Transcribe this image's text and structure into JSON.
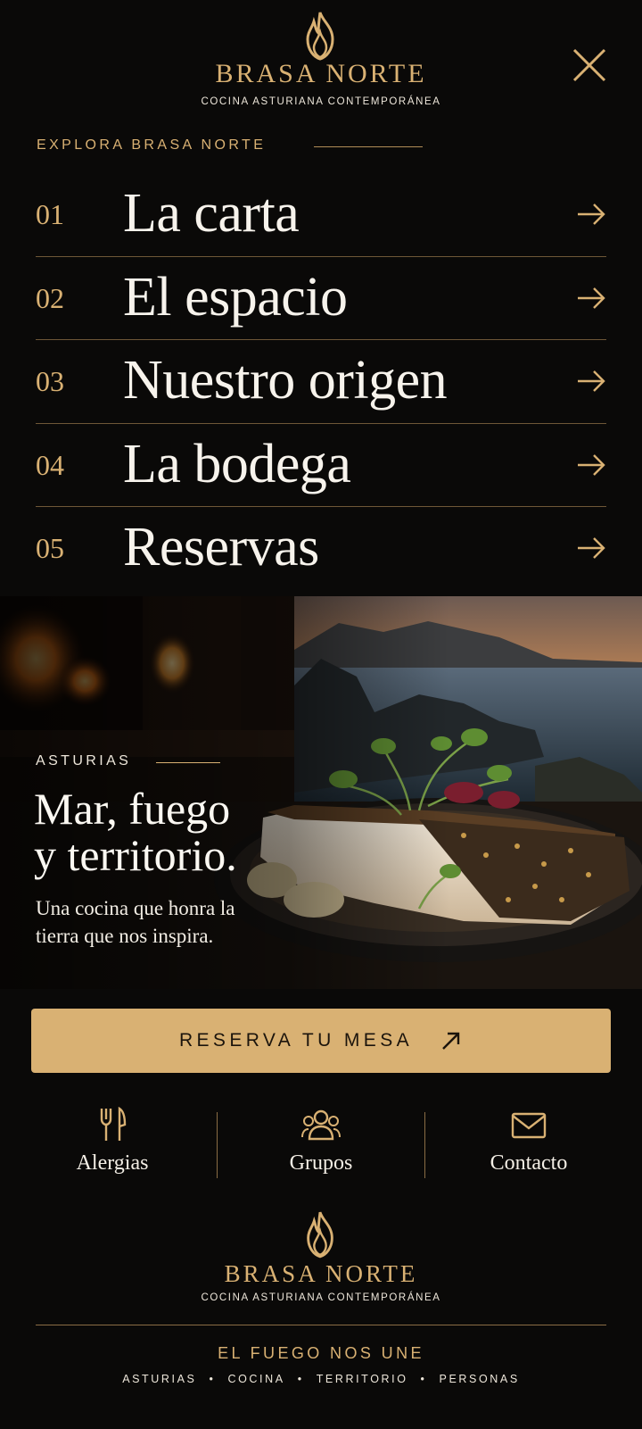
{
  "header": {
    "brand_name": "BRASA NORTE",
    "brand_tagline": "COCINA ASTURIANA CONTEMPORÁNEA",
    "close_icon": "close-icon"
  },
  "explore": {
    "label": "EXPLORA BRASA NORTE"
  },
  "nav": {
    "items": [
      {
        "number": "01",
        "label": "La carta",
        "icon": "arrow-right-icon"
      },
      {
        "number": "02",
        "label": "El espacio",
        "icon": "arrow-right-icon"
      },
      {
        "number": "03",
        "label": "Nuestro origen",
        "icon": "arrow-right-icon"
      },
      {
        "number": "04",
        "label": "La bodega",
        "icon": "arrow-right-icon"
      },
      {
        "number": "05",
        "label": "Reservas",
        "icon": "arrow-right-icon"
      }
    ]
  },
  "hero": {
    "kicker": "ASTURIAS",
    "title_line1": "Mar, fuego",
    "title_line2": "y territorio.",
    "description": "Una cocina que honra la tierra que nos inspira."
  },
  "cta": {
    "label": "RESERVA TU MESA",
    "icon": "arrow-up-right-icon"
  },
  "quick_links": [
    {
      "label": "Alergias",
      "icon": "fork-knife-icon"
    },
    {
      "label": "Grupos",
      "icon": "users-icon"
    },
    {
      "label": "Contacto",
      "icon": "envelope-icon"
    }
  ],
  "footer": {
    "brand_name": "BRASA NORTE",
    "brand_tagline": "COCINA ASTURIANA CONTEMPORÁNEA",
    "tagline": "EL FUEGO NOS UNE",
    "words": [
      "ASTURIAS",
      "COCINA",
      "TERRITORIO",
      "PERSONAS"
    ]
  },
  "colors": {
    "background": "#0a0908",
    "accent_gold": "#d9b173",
    "text_light": "#f4efe6"
  }
}
